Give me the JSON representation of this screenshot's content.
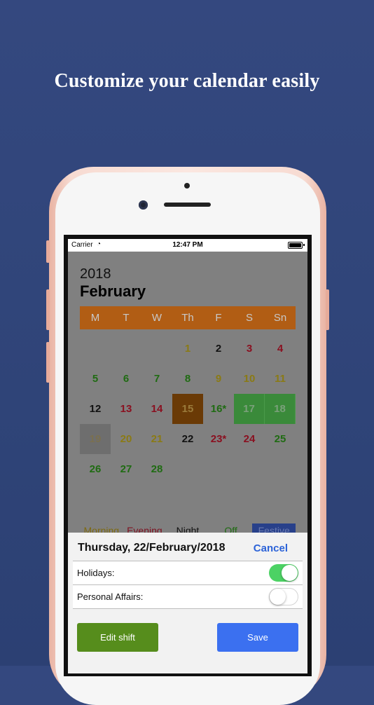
{
  "headline": "Customize your calendar easily",
  "status_bar": {
    "carrier": "Carrier",
    "wifi_icon": "◔",
    "time": "12:47 PM"
  },
  "calendar": {
    "year": "2018",
    "month": "February",
    "weekdays": [
      "M",
      "T",
      "W",
      "Th",
      "F",
      "S",
      "Sn"
    ],
    "weeks": [
      [
        {
          "d": "",
          "s": ""
        },
        {
          "d": "",
          "s": ""
        },
        {
          "d": "",
          "s": ""
        },
        {
          "d": "1",
          "s": "yellow"
        },
        {
          "d": "2",
          "s": "black"
        },
        {
          "d": "3",
          "s": "red"
        },
        {
          "d": "4",
          "s": "red"
        }
      ],
      [
        {
          "d": "5",
          "s": "green"
        },
        {
          "d": "6",
          "s": "green"
        },
        {
          "d": "7",
          "s": "green"
        },
        {
          "d": "8",
          "s": "green"
        },
        {
          "d": "9",
          "s": "yellow"
        },
        {
          "d": "10",
          "s": "yellow"
        },
        {
          "d": "11",
          "s": "yellow"
        }
      ],
      [
        {
          "d": "12",
          "s": "black"
        },
        {
          "d": "13",
          "s": "red"
        },
        {
          "d": "14",
          "s": "red"
        },
        {
          "d": "15",
          "s": "today"
        },
        {
          "d": "16*",
          "s": "green"
        },
        {
          "d": "17",
          "s": "festive"
        },
        {
          "d": "18",
          "s": "festive"
        }
      ],
      [
        {
          "d": "19",
          "s": "selected"
        },
        {
          "d": "20",
          "s": "yellow"
        },
        {
          "d": "21",
          "s": "yellow"
        },
        {
          "d": "22",
          "s": "black"
        },
        {
          "d": "23*",
          "s": "red"
        },
        {
          "d": "24",
          "s": "red"
        },
        {
          "d": "25",
          "s": "green"
        }
      ],
      [
        {
          "d": "26",
          "s": "green"
        },
        {
          "d": "27",
          "s": "green"
        },
        {
          "d": "28",
          "s": "green"
        },
        {
          "d": "",
          "s": ""
        },
        {
          "d": "",
          "s": ""
        },
        {
          "d": "",
          "s": ""
        },
        {
          "d": "",
          "s": ""
        }
      ]
    ],
    "legend": [
      "Morning",
      "Evening",
      "Night",
      "Off",
      "Festive"
    ]
  },
  "sheet": {
    "date_title": "Thursday, 22/February/2018",
    "cancel_label": "Cancel",
    "holidays_label": "Holidays:",
    "holidays_on": true,
    "personal_label": "Personal Affairs:",
    "personal_on": false,
    "edit_label": "Edit shift",
    "save_label": "Save"
  },
  "colors": {
    "background": "#30467c",
    "weekday_header": "#b15d14",
    "toggle_on": "#4cd264",
    "edit_button": "#568d1c",
    "save_button": "#3b70f0",
    "cancel_link": "#2c63d8"
  }
}
